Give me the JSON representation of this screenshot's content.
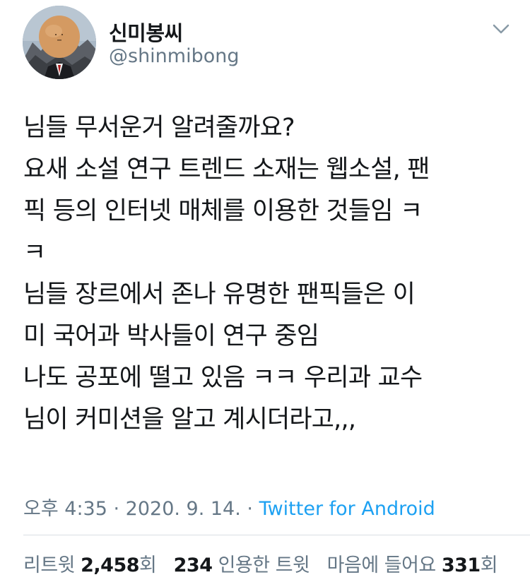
{
  "user": {
    "display_name": "신미봉씨",
    "handle": "@shinmibong"
  },
  "icons": {
    "avatar": "avatar-image",
    "menu": "chevron-down-icon"
  },
  "tweet": {
    "lines": [
      "님들 무서운거 알려줄까요?",
      "요새 소설 연구 트렌드 소재는 웹소설, 팬",
      "픽 등의 인터넷 매체를 이용한 것들임 ㅋ",
      "ㅋ",
      "님들 장르에서 존나 유명한 팬픽들은 이",
      "미 국어과 박사들이 연구 중임",
      "나도 공포에 떨고 있음 ㅋㅋ 우리과 교수",
      "님이 커미션을 알고 계시더라고,,,"
    ]
  },
  "meta": {
    "time": "오후 4:35",
    "separator": " · ",
    "date": "2020. 9. 14.",
    "source": "Twitter for Android"
  },
  "stats": {
    "retweets_label": "리트윗",
    "retweets_count": "2,458",
    "retweets_unit": "회",
    "quotes_count": "234",
    "quotes_label": "인용한 트윗",
    "likes_label": "마음에 들어요",
    "likes_count": "331",
    "likes_unit": "회"
  },
  "colors": {
    "text": "#14171a",
    "secondary": "#657786",
    "link": "#1da1f2",
    "divider": "#d9dfe3"
  }
}
